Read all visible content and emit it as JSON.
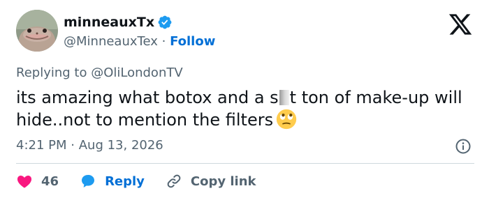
{
  "author": {
    "display_name": "minneauxTx",
    "handle": "@MinneauxTex",
    "separator": "·",
    "follow_label": "Follow",
    "avatar_icon": "ostrich-avatar",
    "verified_color": "#1d9bf0"
  },
  "reply_context": {
    "prefix": "Replying to ",
    "mention": "@OliLondonTV"
  },
  "tweet": {
    "text_part1": "its amazing what botox and a s",
    "text_part2": "t ton of make-up will hide..not to mention the filters",
    "emoji": "face-with-rolling-eyes"
  },
  "meta": {
    "time": "4:21 PM",
    "separator": "·",
    "date": "Aug 13, 2026"
  },
  "actions": {
    "like_count": "46",
    "reply_label": "Reply",
    "copy_label": "Copy link"
  },
  "colors": {
    "like": "#f91880",
    "reply": "#1d9bf0",
    "link": "#006fd6",
    "muted": "#536471"
  }
}
